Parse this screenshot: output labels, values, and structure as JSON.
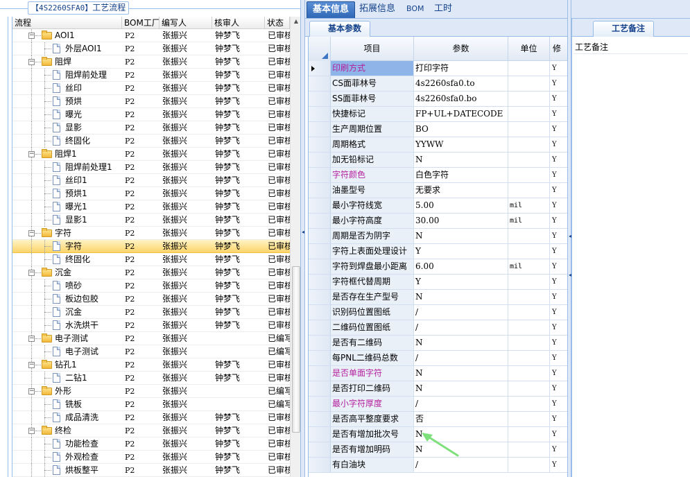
{
  "left_panel": {
    "title_code": "【4S2260SFA0】",
    "title_text": "工艺流程",
    "columns": [
      "流程",
      "BOM工厂",
      "编写人",
      "核审人",
      "状态"
    ],
    "rows": [
      {
        "level": 1,
        "kind": "folder",
        "name": "AOI1",
        "bom": "P2",
        "writer": "张振兴",
        "reviewer": "钟梦飞",
        "status": "已审核"
      },
      {
        "level": 2,
        "kind": "doc",
        "name": "外层AOI1",
        "bom": "P2",
        "writer": "张振兴",
        "reviewer": "钟梦飞",
        "status": "已审核"
      },
      {
        "level": 1,
        "kind": "folder",
        "name": "阻焊",
        "bom": "P2",
        "writer": "张振兴",
        "reviewer": "钟梦飞",
        "status": "已审核"
      },
      {
        "level": 2,
        "kind": "doc",
        "name": "阻焊前处理",
        "bom": "P2",
        "writer": "张振兴",
        "reviewer": "钟梦飞",
        "status": "已审核"
      },
      {
        "level": 2,
        "kind": "doc",
        "name": "丝印",
        "bom": "P2",
        "writer": "张振兴",
        "reviewer": "钟梦飞",
        "status": "已审核"
      },
      {
        "level": 2,
        "kind": "doc",
        "name": "预烘",
        "bom": "P2",
        "writer": "张振兴",
        "reviewer": "钟梦飞",
        "status": "已审核"
      },
      {
        "level": 2,
        "kind": "doc",
        "name": "曝光",
        "bom": "P2",
        "writer": "张振兴",
        "reviewer": "钟梦飞",
        "status": "已审核"
      },
      {
        "level": 2,
        "kind": "doc",
        "name": "显影",
        "bom": "P2",
        "writer": "张振兴",
        "reviewer": "钟梦飞",
        "status": "已审核"
      },
      {
        "level": 2,
        "kind": "doc",
        "name": "终固化",
        "bom": "P2",
        "writer": "张振兴",
        "reviewer": "钟梦飞",
        "status": "已审核"
      },
      {
        "level": 1,
        "kind": "folder",
        "name": "阻焊1",
        "bom": "P2",
        "writer": "张振兴",
        "reviewer": "钟梦飞",
        "status": "已审核"
      },
      {
        "level": 2,
        "kind": "doc",
        "name": "阻焊前处理1",
        "bom": "P2",
        "writer": "张振兴",
        "reviewer": "钟梦飞",
        "status": "已审核"
      },
      {
        "level": 2,
        "kind": "doc",
        "name": "丝印1",
        "bom": "P2",
        "writer": "张振兴",
        "reviewer": "钟梦飞",
        "status": "已审核"
      },
      {
        "level": 2,
        "kind": "doc",
        "name": "预烘1",
        "bom": "P2",
        "writer": "张振兴",
        "reviewer": "钟梦飞",
        "status": "已审核"
      },
      {
        "level": 2,
        "kind": "doc",
        "name": "曝光1",
        "bom": "P2",
        "writer": "张振兴",
        "reviewer": "钟梦飞",
        "status": "已审核"
      },
      {
        "level": 2,
        "kind": "doc",
        "name": "显影1",
        "bom": "P2",
        "writer": "张振兴",
        "reviewer": "钟梦飞",
        "status": "已审核"
      },
      {
        "level": 1,
        "kind": "folder",
        "name": "字符",
        "bom": "P2",
        "writer": "张振兴",
        "reviewer": "钟梦飞",
        "status": "已审核"
      },
      {
        "level": 2,
        "kind": "doc",
        "name": "字符",
        "bom": "P2",
        "writer": "张振兴",
        "reviewer": "钟梦飞",
        "status": "已审核",
        "selected": true
      },
      {
        "level": 2,
        "kind": "doc",
        "name": "终固化",
        "bom": "P2",
        "writer": "张振兴",
        "reviewer": "钟梦飞",
        "status": "已审核"
      },
      {
        "level": 1,
        "kind": "folder",
        "name": "沉金",
        "bom": "P2",
        "writer": "张振兴",
        "reviewer": "钟梦飞",
        "status": "已审核"
      },
      {
        "level": 2,
        "kind": "doc",
        "name": "喷砂",
        "bom": "P2",
        "writer": "张振兴",
        "reviewer": "钟梦飞",
        "status": "已审核"
      },
      {
        "level": 2,
        "kind": "doc",
        "name": "板边包胶",
        "bom": "P2",
        "writer": "张振兴",
        "reviewer": "钟梦飞",
        "status": "已审核"
      },
      {
        "level": 2,
        "kind": "doc",
        "name": "沉金",
        "bom": "P2",
        "writer": "张振兴",
        "reviewer": "钟梦飞",
        "status": "已审核"
      },
      {
        "level": 2,
        "kind": "doc",
        "name": "水洗烘干",
        "bom": "P2",
        "writer": "张振兴",
        "reviewer": "钟梦飞",
        "status": "已审核"
      },
      {
        "level": 1,
        "kind": "folder",
        "name": "电子测试",
        "bom": "P2",
        "writer": "张振兴",
        "reviewer": "",
        "status": "已编写"
      },
      {
        "level": 2,
        "kind": "doc",
        "name": "电子测试",
        "bom": "P2",
        "writer": "张振兴",
        "reviewer": "",
        "status": "已编写"
      },
      {
        "level": 1,
        "kind": "folder",
        "name": "钻孔1",
        "bom": "P2",
        "writer": "张振兴",
        "reviewer": "钟梦飞",
        "status": "已审核"
      },
      {
        "level": 2,
        "kind": "doc",
        "name": "二钻1",
        "bom": "P2",
        "writer": "张振兴",
        "reviewer": "钟梦飞",
        "status": "已审核"
      },
      {
        "level": 1,
        "kind": "folder",
        "name": "外形",
        "bom": "P2",
        "writer": "张振兴",
        "reviewer": "",
        "status": "已编写"
      },
      {
        "level": 2,
        "kind": "doc",
        "name": "铣板",
        "bom": "P2",
        "writer": "张振兴",
        "reviewer": "",
        "status": "已编写"
      },
      {
        "level": 2,
        "kind": "doc",
        "name": "成品清洗",
        "bom": "P2",
        "writer": "张振兴",
        "reviewer": "钟梦飞",
        "status": "已审核"
      },
      {
        "level": 1,
        "kind": "folder",
        "name": "终检",
        "bom": "P2",
        "writer": "张振兴",
        "reviewer": "钟梦飞",
        "status": "已审核"
      },
      {
        "level": 2,
        "kind": "doc",
        "name": "功能检查",
        "bom": "P2",
        "writer": "张振兴",
        "reviewer": "钟梦飞",
        "status": "已审核"
      },
      {
        "level": 2,
        "kind": "doc",
        "name": "外观检查",
        "bom": "P2",
        "writer": "张振兴",
        "reviewer": "钟梦飞",
        "status": "已审核"
      },
      {
        "level": 2,
        "kind": "doc",
        "name": "烘板整平",
        "bom": "P2",
        "writer": "张振兴",
        "reviewer": "钟梦飞",
        "status": "已审核"
      }
    ]
  },
  "tabs": [
    "基本信息",
    "拓展信息",
    "BOM",
    "工时"
  ],
  "active_tab": 0,
  "subtab": "基本参数",
  "grid": {
    "columns": [
      "项目",
      "参数",
      "单位",
      "修"
    ],
    "rows": [
      {
        "item": "印刷方式",
        "value": "打印字符",
        "unit": "",
        "flag": "Y",
        "style": "highlight",
        "current": true
      },
      {
        "item": "CS面菲林号",
        "value": "4s2260sfa0.to",
        "unit": "",
        "flag": "Y"
      },
      {
        "item": "SS面菲林号",
        "value": "4s2260sfa0.bo",
        "unit": "",
        "flag": "Y"
      },
      {
        "item": "快捷标记",
        "value": "FP+UL+DATECODE",
        "unit": "",
        "flag": "Y"
      },
      {
        "item": "生产周期位置",
        "value": "BO",
        "unit": "",
        "flag": "Y"
      },
      {
        "item": "周期格式",
        "value": "YYWW",
        "unit": "",
        "flag": "Y"
      },
      {
        "item": "加无铅标记",
        "value": "N",
        "unit": "",
        "flag": "Y"
      },
      {
        "item": "字符颜色",
        "value": "白色字符",
        "unit": "",
        "flag": "Y",
        "style": "magenta"
      },
      {
        "item": "油墨型号",
        "value": "无要求",
        "unit": "",
        "flag": "Y"
      },
      {
        "item": "最小字符线宽",
        "value": "5.00",
        "unit": "mil",
        "flag": "Y"
      },
      {
        "item": "最小字符高度",
        "value": "30.00",
        "unit": "mil",
        "flag": "Y"
      },
      {
        "item": "周期是否为阴字",
        "value": "N",
        "unit": "",
        "flag": "Y"
      },
      {
        "item": "字符上表面处理设计",
        "value": "Y",
        "unit": "",
        "flag": "Y"
      },
      {
        "item": "字符到焊盘最小距离",
        "value": "6.00",
        "unit": "mil",
        "flag": "Y"
      },
      {
        "item": "字符框代替周期",
        "value": "Y",
        "unit": "",
        "flag": "Y"
      },
      {
        "item": "是否存在生产型号",
        "value": "N",
        "unit": "",
        "flag": "Y"
      },
      {
        "item": "识别码位置图纸",
        "value": "/",
        "unit": "",
        "flag": "Y"
      },
      {
        "item": "二维码位置图纸",
        "value": "/",
        "unit": "",
        "flag": "Y"
      },
      {
        "item": "是否有二维码",
        "value": "N",
        "unit": "",
        "flag": "Y"
      },
      {
        "item": "每PNL二维码总数",
        "value": "/",
        "unit": "",
        "flag": "Y"
      },
      {
        "item": "是否单面字符",
        "value": "N",
        "unit": "",
        "flag": "Y",
        "style": "magenta"
      },
      {
        "item": "是否打印二维码",
        "value": "N",
        "unit": "",
        "flag": "Y"
      },
      {
        "item": "最小字符厚度",
        "value": "/",
        "unit": "",
        "flag": "Y",
        "style": "magenta"
      },
      {
        "item": "是否高平整度要求",
        "value": "否",
        "unit": "",
        "flag": "Y"
      },
      {
        "item": "是否有增加批次号",
        "value": "N",
        "unit": "",
        "flag": "Y"
      },
      {
        "item": "是否有增加明码",
        "value": "N",
        "unit": "",
        "flag": "Y"
      },
      {
        "item": "有白油块",
        "value": "/",
        "unit": "",
        "flag": "Y"
      }
    ]
  },
  "notes": {
    "tab": "工艺备注",
    "label": "工艺备注"
  },
  "colors": {
    "accent": "#15428b",
    "tab_active": "#2f67b6",
    "highlight_item": "#8fb5e8",
    "magenta_text": "#b4209f",
    "selected_row": "#fcd56a",
    "annotation_arrow": "#7ee07a"
  }
}
